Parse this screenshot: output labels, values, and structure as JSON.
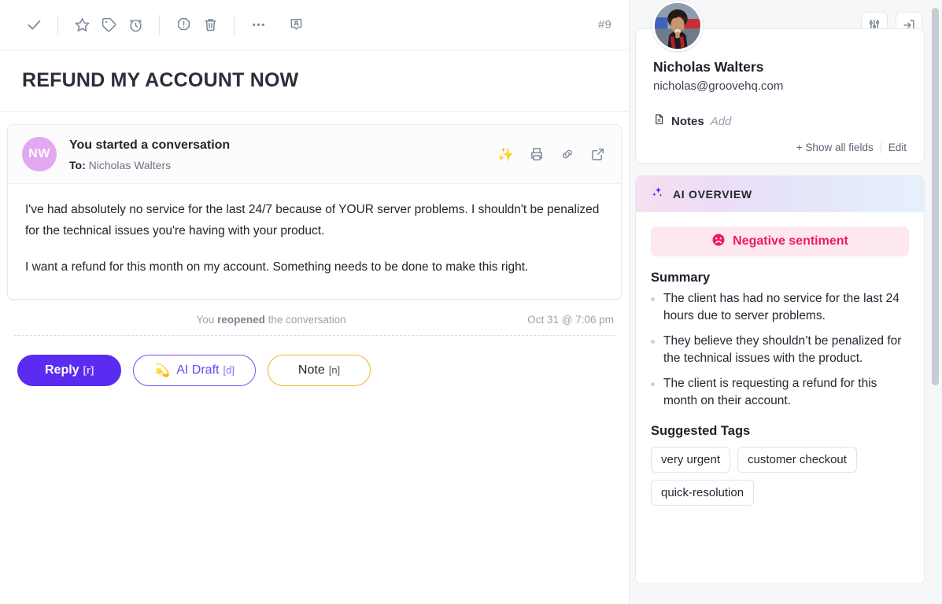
{
  "toolbar": {
    "icons": [
      {
        "name": "check-icon",
        "label": "Close conversation"
      },
      {
        "name": "star-icon",
        "label": "Star"
      },
      {
        "name": "tag-icon",
        "label": "Tag"
      },
      {
        "name": "snooze-clock-icon",
        "label": "Snooze"
      },
      {
        "name": "spam-icon",
        "label": "Spam"
      },
      {
        "name": "trash-icon",
        "label": "Delete"
      },
      {
        "name": "more-options-icon",
        "label": "More"
      },
      {
        "name": "assign-user-icon",
        "label": "Assign"
      }
    ],
    "ticket_number": "#9"
  },
  "subject": {
    "title": "REFUND MY ACCOUNT NOW"
  },
  "message": {
    "avatar_initials": "NW",
    "avatar_color": "#e2a8f0",
    "title": "You started a conversation",
    "to_label": "To:",
    "to_name": "Nicholas Walters",
    "actions": [
      {
        "name": "ai-sparkle-icon",
        "glyph": "✨"
      },
      {
        "name": "print-icon"
      },
      {
        "name": "copy-link-icon"
      },
      {
        "name": "open-external-icon"
      }
    ],
    "paragraphs": [
      "I've had absolutely no service for the last 24/7 because of YOUR server problems. I shouldn't be penalized for the technical issues you're having with your product.",
      "I want a refund for this month on my account. Something needs to be done to make this right."
    ]
  },
  "event": {
    "prefix": "You ",
    "action": "reopened",
    "suffix": " the conversation",
    "timestamp": "Oct 31 @ 7:06 pm"
  },
  "reply_bar": {
    "reply_label": "Reply",
    "reply_hint": "[r]",
    "reply_color": "#5a2bf0",
    "ai_draft_label": "AI Draft",
    "ai_draft_hint": "[d]",
    "ai_draft_icon": "💫",
    "ai_draft_color": "#6b46f0",
    "note_label": "Note",
    "note_hint": "[n]",
    "note_color": "#f0b429"
  },
  "sidebar": {
    "top_icons": [
      {
        "name": "filter-sliders-icon",
        "label": "Properties"
      },
      {
        "name": "collapse-panel-icon",
        "label": "Collapse sidebar"
      }
    ],
    "contact": {
      "name": "Nicholas Walters",
      "email": "nicholas@groovehq.com",
      "notes_label": "Notes",
      "notes_add": "Add",
      "show_all_fields": "+ Show all fields",
      "edit": "Edit"
    },
    "ai_overview": {
      "header": "AI OVERVIEW",
      "sentiment": {
        "label": "Negative sentiment",
        "emoji": "☹",
        "text_color": "#f0195f",
        "bg_color": "#fde7f0"
      },
      "summary_title": "Summary",
      "summary_points": [
        "The client has had no service for the last 24 hours due to server problems.",
        "They believe they shouldn’t be penalized for the technical issues with the product.",
        "The client is requesting a refund for this month on their account."
      ],
      "tags_title": "Suggested Tags",
      "tags": [
        "very urgent",
        "customer checkout",
        "quick-resolution"
      ]
    }
  }
}
